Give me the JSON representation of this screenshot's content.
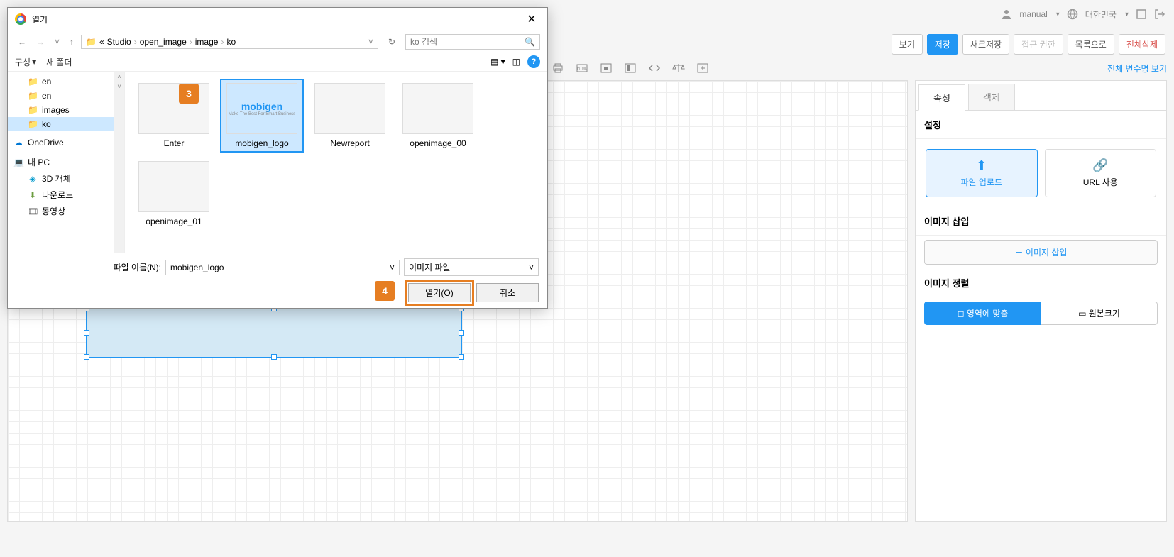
{
  "header": {
    "user_label": "manual",
    "region_label": "대한민국"
  },
  "actions": {
    "view": "보기",
    "save": "저장",
    "save_as": "새로저장",
    "permission": "접근 권한",
    "to_list": "목록으로",
    "delete_all": "전체삭제"
  },
  "toolbar_link": "전체 변수명 보기",
  "right_panel": {
    "tabs": {
      "props": "속성",
      "object": "객체"
    },
    "settings_title": "설정",
    "upload": {
      "file_upload": "파일 업로드",
      "url_use": "URL 사용"
    },
    "insert_title": "이미지 삽입",
    "insert_btn": "이미지 삽입",
    "align_title": "이미지 정렬",
    "align": {
      "fit": "영역에 맞춤",
      "original": "원본크기"
    }
  },
  "dialog": {
    "title": "열기",
    "breadcrumb": [
      "Studio",
      "open_image",
      "image",
      "ko"
    ],
    "search_placeholder": "ko 검색",
    "toolbar": {
      "organize": "구성",
      "new_folder": "새 폴더"
    },
    "tree": [
      {
        "label": "en",
        "icon": "folder"
      },
      {
        "label": "en",
        "icon": "folder"
      },
      {
        "label": "images",
        "icon": "folder"
      },
      {
        "label": "ko",
        "icon": "folder",
        "selected": true
      },
      {
        "label": "OneDrive",
        "icon": "cloud",
        "root": true
      },
      {
        "label": "내 PC",
        "icon": "pc",
        "root": true
      },
      {
        "label": "3D 개체",
        "icon": "3d"
      },
      {
        "label": "다운로드",
        "icon": "download"
      },
      {
        "label": "동영상",
        "icon": "video"
      }
    ],
    "files": [
      {
        "name": "Enter",
        "thumb": "doc"
      },
      {
        "name": "mobigen_logo",
        "thumb": "mobigen",
        "selected": true
      },
      {
        "name": "Newreport",
        "thumb": "doc"
      },
      {
        "name": "openimage_00",
        "thumb": "doc"
      },
      {
        "name": "openimage_01",
        "thumb": "doc"
      }
    ],
    "filename_label": "파일 이름(N):",
    "filename_value": "mobigen_logo",
    "filter_label": "이미지 파일",
    "open_btn": "열기(O)",
    "cancel_btn": "취소"
  },
  "callouts": {
    "c3": "3",
    "c4": "4"
  },
  "mobigen_logo_text": "mobigen",
  "mobigen_logo_sub": "Make The Best For Smart Business"
}
